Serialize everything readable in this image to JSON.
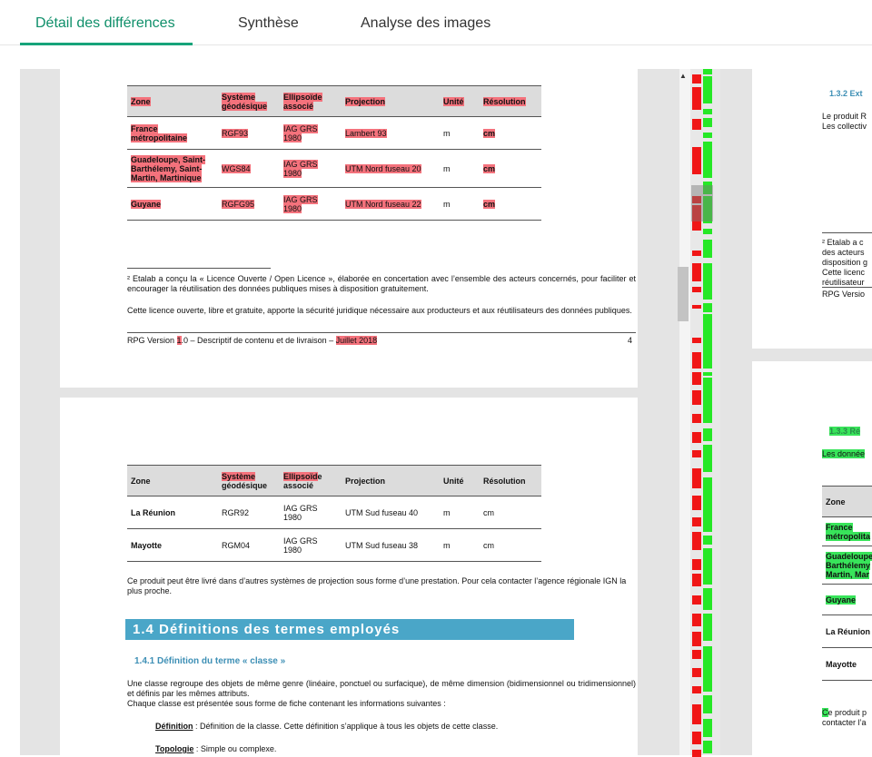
{
  "tabs": [
    {
      "label": "Détail des différences"
    },
    {
      "label": "Synthèse"
    },
    {
      "label": "Analyse des images"
    }
  ],
  "left": {
    "table1": {
      "headers": [
        "Zone",
        "Système géodésique",
        "Ellipsoïde associé",
        "Projection",
        "Unité",
        "Résolution"
      ],
      "rows": [
        [
          "France métropolitaine",
          "RGF93",
          "IAG GRS 1980",
          "Lambert 93",
          "m",
          "cm"
        ],
        [
          "Guadeloupe, Saint-Barthélemy, Saint-Martin, Martinique",
          "WGS84",
          "IAG GRS 1980",
          "UTM Nord fuseau 20",
          "m",
          "cm"
        ],
        [
          "Guyane",
          "RGFG95",
          "IAG GRS 1980",
          "UTM Nord fuseau 22",
          "m",
          "cm"
        ]
      ]
    },
    "footnote": "² Etalab a conçu la « Licence Ouverte / Open Licence », élaborée en concertation avec l’ensemble des acteurs concernés, pour faciliter et encourager la réutilisation des données publiques mises à disposition gratuitement.",
    "footnote2": "Cette licence ouverte, libre et gratuite, apporte la sécurité juridique nécessaire aux producteurs et aux réutilisateurs des données publiques.",
    "footer_pre": "RPG Version ",
    "footer_ver": "1",
    "footer_mid": ".0 – Descriptif de contenu et de livraison – ",
    "footer_date": "Juillet 2018",
    "footer_page": "4",
    "table2": {
      "headers": [
        "Zone",
        "Système géodésique",
        "Ellipsoïde associé",
        "Projection",
        "Unité",
        "Résolution"
      ],
      "header_sys_hl": "Système",
      "header_sys_rest": "géodésique",
      "header_ell_hl": "Ellipsoïd",
      "header_ell_rest": "e",
      "header_ell_line2": "associé",
      "rows": [
        [
          "La Réunion",
          "RGR92",
          "IAG GRS 1980",
          "UTM Sud fuseau 40",
          "m",
          "cm"
        ],
        [
          "Mayotte",
          "RGM04",
          "IAG GRS 1980",
          "UTM Sud fuseau 38",
          "m",
          "cm"
        ]
      ]
    },
    "para1": "Ce produit peut être livré dans d’autres systèmes de projection sous forme d’une prestation. Pour cela contacter l’agence régionale IGN la plus proche.",
    "section_title": "1.4 Définitions des termes employés",
    "subsection": "1.4.1 Définition du terme « classe »",
    "para2": "Une classe regroupe des objets de même genre (linéaire, ponctuel ou surfacique), de même dimension (bidimensionnel ou tridimensionnel) et définis par les mêmes attributs.",
    "para3": "Chaque classe est présentée sous forme de fiche contenant les informations suivantes :",
    "def_label": "Définition",
    "def_text": " : Définition de la classe. Cette définition s’applique à tous les objets de cette classe.",
    "topo_label": "Topologie",
    "topo_text": " : Simple ou complexe."
  },
  "right": {
    "heading1": "1.3.2 Ext",
    "p1a": "Le produit R",
    "p1b": "Les collectiv",
    "fn1": "² Etalab a c",
    "fn2": "des acteurs",
    "fn3": "disposition g",
    "fn4": "Cette licenc",
    "fn5": "réutilisateur",
    "footer": "RPG Versio",
    "heading2": "1.3.3 Ré",
    "p2": "Les donnée",
    "t_header": "Zone",
    "t_rows": [
      "France métropolita",
      "Guadeloupe Barthélemy Martin, Mar",
      "Guyane",
      "La Réunion",
      "Mayotte"
    ],
    "p3_hl": "C",
    "p3a": "e produit p",
    "p3b": "contacter l’a"
  },
  "colors": {
    "accent": "#16a37a",
    "removed": "#f4727c",
    "added": "#38e45a",
    "section": "#4aa6c8"
  }
}
